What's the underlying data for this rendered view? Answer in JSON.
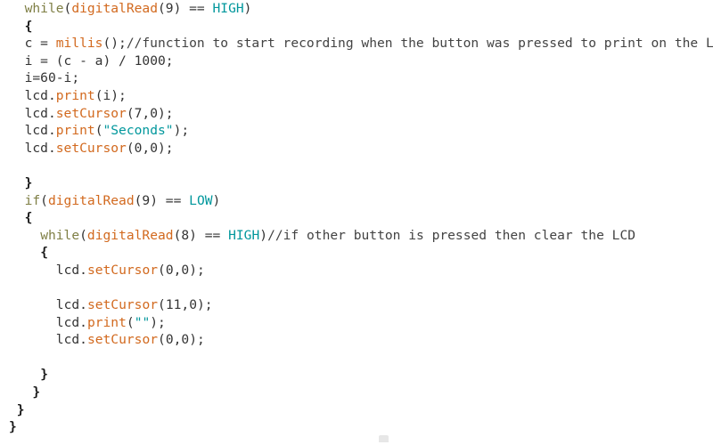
{
  "page": {
    "background_color": "#ffffff",
    "kind": "source-code-listing",
    "language": "arduino-c"
  },
  "theme": {
    "plain_color": "#333333",
    "keyword_color": "#7f7f45",
    "function_color": "#d2691e",
    "constant_color": "#00979c",
    "string_color": "#00979c",
    "comment_color": "#434343",
    "brace_color": "#1a1a1a"
  },
  "code": {
    "lines": [
      {
        "indent": 2,
        "tokens": [
          {
            "t": "while",
            "c": "kw"
          },
          {
            "t": "(",
            "c": "punc"
          },
          {
            "t": "digitalRead",
            "c": "fn"
          },
          {
            "t": "(",
            "c": "punc"
          },
          {
            "t": "9",
            "c": "num"
          },
          {
            "t": ") == ",
            "c": "punc"
          },
          {
            "t": "HIGH",
            "c": "const"
          },
          {
            "t": ")",
            "c": "punc"
          }
        ]
      },
      {
        "indent": 2,
        "tokens": [
          {
            "t": "{",
            "c": "brace"
          }
        ]
      },
      {
        "indent": 2,
        "tokens": [
          {
            "t": "c = ",
            "c": "plain"
          },
          {
            "t": "millis",
            "c": "fn"
          },
          {
            "t": "();",
            "c": "punc"
          },
          {
            "t": "//function to start recording when the button was pressed to print on the LCD",
            "c": "comment"
          }
        ]
      },
      {
        "indent": 2,
        "tokens": [
          {
            "t": "i = (c - ",
            "c": "plain"
          },
          {
            "t": "a",
            "c": "plain"
          },
          {
            "t": ") / ",
            "c": "plain"
          },
          {
            "t": "1000",
            "c": "num"
          },
          {
            "t": ";",
            "c": "punc"
          }
        ]
      },
      {
        "indent": 2,
        "tokens": [
          {
            "t": "i=",
            "c": "plain"
          },
          {
            "t": "60",
            "c": "num"
          },
          {
            "t": "-i;",
            "c": "plain"
          }
        ]
      },
      {
        "indent": 2,
        "tokens": [
          {
            "t": "lcd.",
            "c": "plain"
          },
          {
            "t": "print",
            "c": "fn"
          },
          {
            "t": "(i);",
            "c": "punc"
          }
        ]
      },
      {
        "indent": 2,
        "tokens": [
          {
            "t": "lcd.",
            "c": "plain"
          },
          {
            "t": "setCursor",
            "c": "fn"
          },
          {
            "t": "(",
            "c": "punc"
          },
          {
            "t": "7",
            "c": "num"
          },
          {
            "t": ",",
            "c": "punc"
          },
          {
            "t": "0",
            "c": "num"
          },
          {
            "t": ");",
            "c": "punc"
          }
        ]
      },
      {
        "indent": 2,
        "tokens": [
          {
            "t": "lcd.",
            "c": "plain"
          },
          {
            "t": "print",
            "c": "fn"
          },
          {
            "t": "(",
            "c": "punc"
          },
          {
            "t": "\"Seconds\"",
            "c": "str"
          },
          {
            "t": ");",
            "c": "punc"
          }
        ]
      },
      {
        "indent": 2,
        "tokens": [
          {
            "t": "lcd.",
            "c": "plain"
          },
          {
            "t": "setCursor",
            "c": "fn"
          },
          {
            "t": "(",
            "c": "punc"
          },
          {
            "t": "0",
            "c": "num"
          },
          {
            "t": ",",
            "c": "punc"
          },
          {
            "t": "0",
            "c": "num"
          },
          {
            "t": ");",
            "c": "punc"
          }
        ]
      },
      {
        "indent": 0,
        "tokens": []
      },
      {
        "indent": 2,
        "tokens": [
          {
            "t": "}",
            "c": "brace"
          }
        ]
      },
      {
        "indent": 2,
        "tokens": [
          {
            "t": "if",
            "c": "kw"
          },
          {
            "t": "(",
            "c": "punc"
          },
          {
            "t": "digitalRead",
            "c": "fn"
          },
          {
            "t": "(",
            "c": "punc"
          },
          {
            "t": "9",
            "c": "num"
          },
          {
            "t": ") == ",
            "c": "punc"
          },
          {
            "t": "LOW",
            "c": "const"
          },
          {
            "t": ")",
            "c": "punc"
          }
        ]
      },
      {
        "indent": 2,
        "tokens": [
          {
            "t": "{",
            "c": "brace"
          }
        ]
      },
      {
        "indent": 4,
        "tokens": [
          {
            "t": "while",
            "c": "kw"
          },
          {
            "t": "(",
            "c": "punc"
          },
          {
            "t": "digitalRead",
            "c": "fn"
          },
          {
            "t": "(",
            "c": "punc"
          },
          {
            "t": "8",
            "c": "num"
          },
          {
            "t": ") == ",
            "c": "punc"
          },
          {
            "t": "HIGH",
            "c": "const"
          },
          {
            "t": ")",
            "c": "punc"
          },
          {
            "t": "//if other button is pressed then clear the LCD",
            "c": "comment"
          }
        ]
      },
      {
        "indent": 4,
        "tokens": [
          {
            "t": "{",
            "c": "brace"
          }
        ]
      },
      {
        "indent": 6,
        "tokens": [
          {
            "t": "lcd.",
            "c": "plain"
          },
          {
            "t": "setCursor",
            "c": "fn"
          },
          {
            "t": "(",
            "c": "punc"
          },
          {
            "t": "0",
            "c": "num"
          },
          {
            "t": ",",
            "c": "punc"
          },
          {
            "t": "0",
            "c": "num"
          },
          {
            "t": ");",
            "c": "punc"
          }
        ]
      },
      {
        "indent": 0,
        "tokens": []
      },
      {
        "indent": 6,
        "tokens": [
          {
            "t": "lcd.",
            "c": "plain"
          },
          {
            "t": "setCursor",
            "c": "fn"
          },
          {
            "t": "(",
            "c": "punc"
          },
          {
            "t": "11",
            "c": "num"
          },
          {
            "t": ",",
            "c": "punc"
          },
          {
            "t": "0",
            "c": "num"
          },
          {
            "t": ");",
            "c": "punc"
          }
        ]
      },
      {
        "indent": 6,
        "tokens": [
          {
            "t": "lcd.",
            "c": "plain"
          },
          {
            "t": "print",
            "c": "fn"
          },
          {
            "t": "(",
            "c": "punc"
          },
          {
            "t": "\"\"",
            "c": "str"
          },
          {
            "t": ");",
            "c": "punc"
          }
        ]
      },
      {
        "indent": 6,
        "tokens": [
          {
            "t": "lcd.",
            "c": "plain"
          },
          {
            "t": "setCursor",
            "c": "fn"
          },
          {
            "t": "(",
            "c": "punc"
          },
          {
            "t": "0",
            "c": "num"
          },
          {
            "t": ",",
            "c": "punc"
          },
          {
            "t": "0",
            "c": "num"
          },
          {
            "t": ");",
            "c": "punc"
          }
        ]
      },
      {
        "indent": 0,
        "tokens": []
      },
      {
        "indent": 4,
        "tokens": [
          {
            "t": "}",
            "c": "brace"
          }
        ]
      },
      {
        "indent": 3,
        "tokens": [
          {
            "t": "}",
            "c": "brace"
          }
        ]
      },
      {
        "indent": 1,
        "tokens": [
          {
            "t": "}",
            "c": "brace"
          }
        ]
      },
      {
        "indent": 0,
        "tokens": [
          {
            "t": "}",
            "c": "brace"
          }
        ]
      }
    ]
  }
}
